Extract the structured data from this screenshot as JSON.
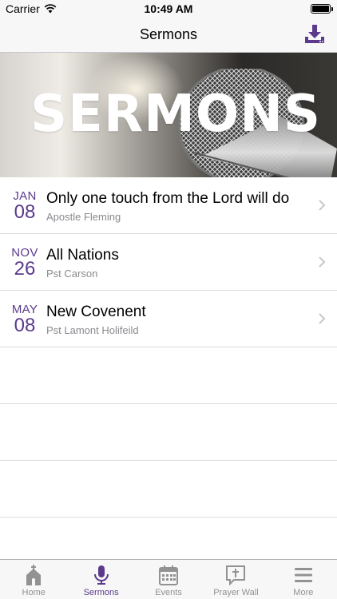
{
  "status_bar": {
    "carrier": "Carrier",
    "time": "10:49 AM"
  },
  "nav": {
    "title": "Sermons"
  },
  "banner": {
    "title": "SERMONS"
  },
  "sermons": [
    {
      "month": "JAN",
      "day": "08",
      "title": "Only one touch from the Lord will do",
      "speaker": "Apostle Fleming"
    },
    {
      "month": "NOV",
      "day": "26",
      "title": "All Nations",
      "speaker": "Pst Carson"
    },
    {
      "month": "MAY",
      "day": "08",
      "title": "New Covenent",
      "speaker": "Pst Lamont Holifeild"
    }
  ],
  "tabs": [
    {
      "label": "Home",
      "icon": "church-icon"
    },
    {
      "label": "Sermons",
      "icon": "microphone-icon",
      "active": true
    },
    {
      "label": "Events",
      "icon": "calendar-icon"
    },
    {
      "label": "Prayer Wall",
      "icon": "prayer-bubble-icon"
    },
    {
      "label": "More",
      "icon": "menu-icon"
    }
  ],
  "colors": {
    "accent": "#5b3a8c",
    "inactive": "#929292",
    "bar_background": "#f7f7f7"
  }
}
